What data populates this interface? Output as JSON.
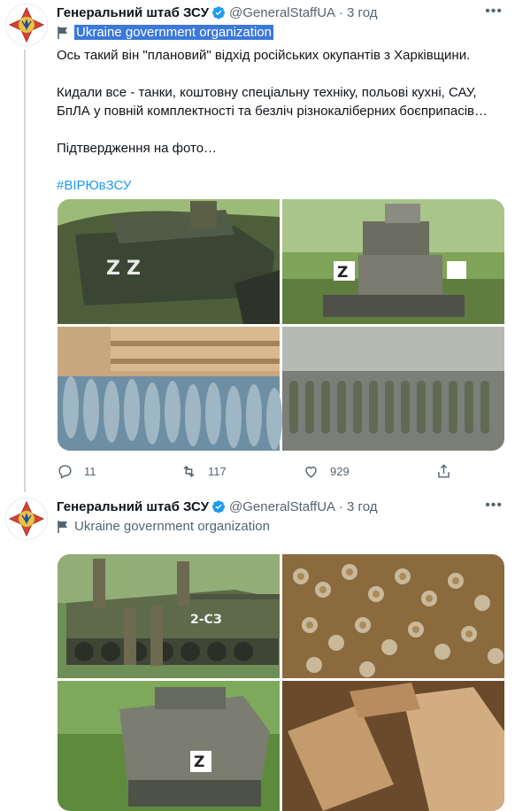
{
  "tweets": [
    {
      "display_name": "Генеральний штаб ЗСУ",
      "handle": "@GeneralStaffUA",
      "separator": "·",
      "time": "3 год",
      "affiliation": "Ukraine government organization",
      "text_line1": "Ось такий він \"плановий\" відхід російських окупантів з Харківщини.",
      "text_line2": "Кидали все - танки, коштовну спеціальну техніку, польові кухні, САУ,",
      "text_line3": "БпЛА у повній комплектності та безліч різнокаліберних боєприпасів…",
      "text_line4": "Підтвердження на фото…",
      "hashtag": "#ВІРЮвЗСУ",
      "reply_count": "11",
      "retweet_count": "117",
      "like_count": "929"
    },
    {
      "display_name": "Генеральний штаб ЗСУ",
      "handle": "@GeneralStaffUA",
      "separator": "·",
      "time": "3 год",
      "affiliation": "Ukraine government organization"
    }
  ],
  "photos": {
    "t1_p1_marking": "Z",
    "t1_p2_marking": "Z",
    "t2_p1_marking": "2-СЗ",
    "t2_p3_marking": "Z"
  },
  "icons": [
    "avatar-emblem",
    "verified-badge-icon",
    "more-icon",
    "government-flag-icon",
    "reply-icon",
    "retweet-icon",
    "like-icon",
    "share-icon"
  ],
  "colors": {
    "accent": "#1d9bf0",
    "muted": "#536471",
    "highlight": "#3b78d8"
  }
}
